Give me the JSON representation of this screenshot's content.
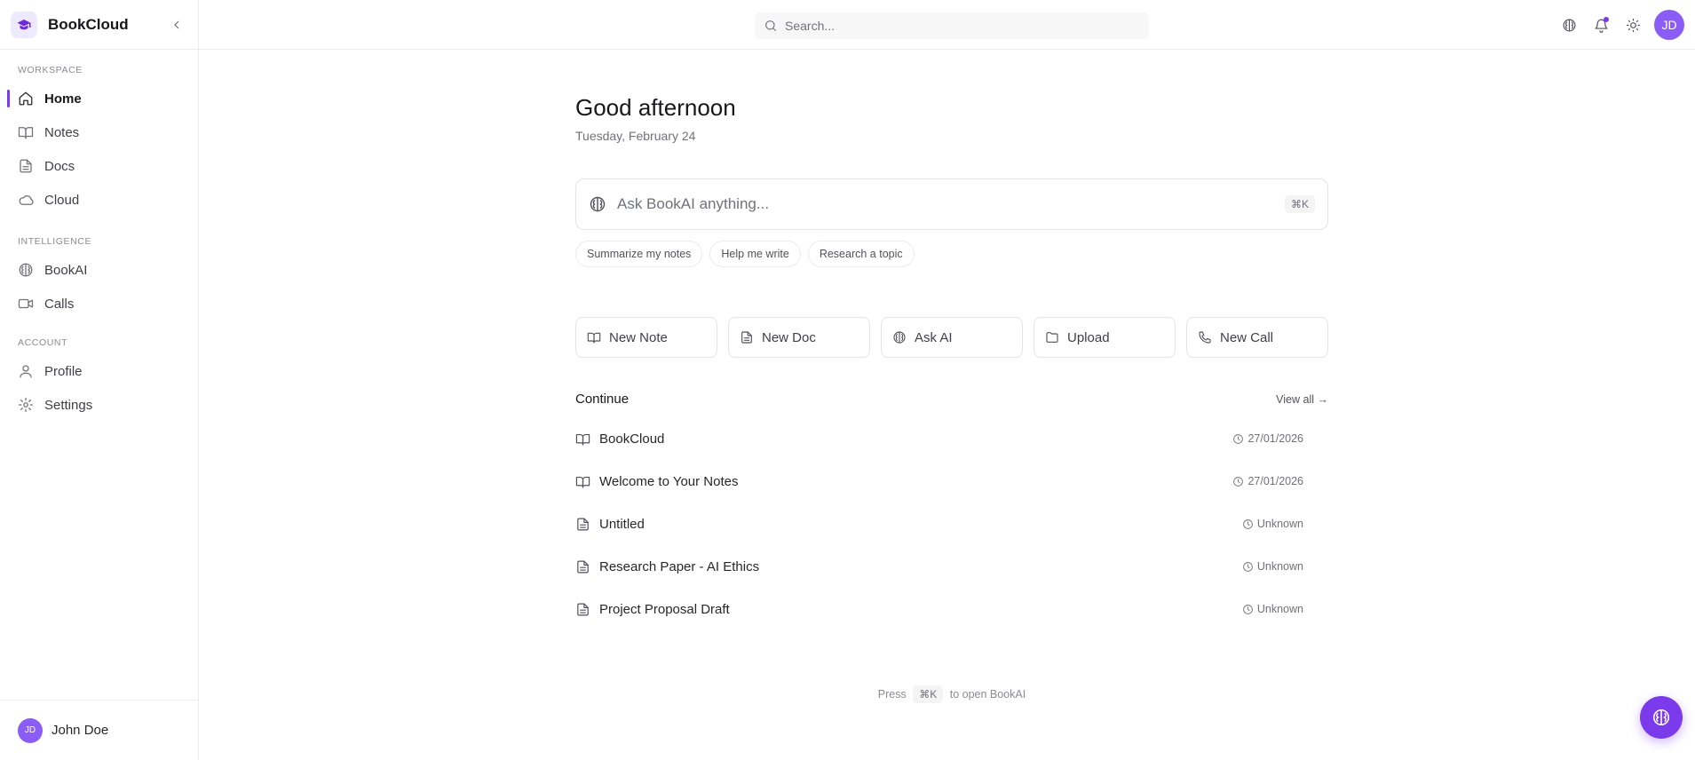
{
  "brand": {
    "name": "BookCloud"
  },
  "sidebar": {
    "sections": [
      {
        "label": "WORKSPACE",
        "items": [
          {
            "label": "Home",
            "icon": "home-icon",
            "active": true
          },
          {
            "label": "Notes",
            "icon": "book-icon"
          },
          {
            "label": "Docs",
            "icon": "file-icon"
          },
          {
            "label": "Cloud",
            "icon": "cloud-icon"
          }
        ]
      },
      {
        "label": "INTELLIGENCE",
        "items": [
          {
            "label": "BookAI",
            "icon": "brain-icon"
          },
          {
            "label": "Calls",
            "icon": "video-icon"
          }
        ]
      },
      {
        "label": "ACCOUNT",
        "items": [
          {
            "label": "Profile",
            "icon": "user-icon"
          },
          {
            "label": "Settings",
            "icon": "gear-icon"
          }
        ]
      }
    ],
    "user": {
      "initials": "JD",
      "name": "John Doe"
    }
  },
  "topbar": {
    "search_placeholder": "Search...",
    "avatar_initials": "JD"
  },
  "main": {
    "greeting": "Good afternoon",
    "date": "Tuesday, February 24",
    "ask": {
      "placeholder": "Ask BookAI anything...",
      "shortcut": "⌘K"
    },
    "suggestions": [
      "Summarize my notes",
      "Help me write",
      "Research a topic"
    ],
    "quick_actions": {
      "new_note": "New Note",
      "new_doc": "New Doc",
      "ask_ai": "Ask AI",
      "upload": "Upload",
      "new_call": "New Call"
    },
    "continue": {
      "title": "Continue",
      "view_all": "View all →",
      "items": [
        {
          "title": "BookCloud",
          "date": "27/01/2026",
          "icon": "book-icon"
        },
        {
          "title": "Welcome to Your Notes",
          "date": "27/01/2026",
          "icon": "book-icon"
        },
        {
          "title": "Untitled",
          "date": "Unknown",
          "icon": "file-icon"
        },
        {
          "title": "Research Paper - AI Ethics",
          "date": "Unknown",
          "icon": "file-icon"
        },
        {
          "title": "Project Proposal Draft",
          "date": "Unknown",
          "icon": "file-icon"
        }
      ]
    },
    "hint": {
      "before": "Press",
      "key": "⌘K",
      "after": "to open BookAI"
    }
  },
  "colors": {
    "accent": "#7c3aed",
    "avatar": "#8b5cf6"
  }
}
